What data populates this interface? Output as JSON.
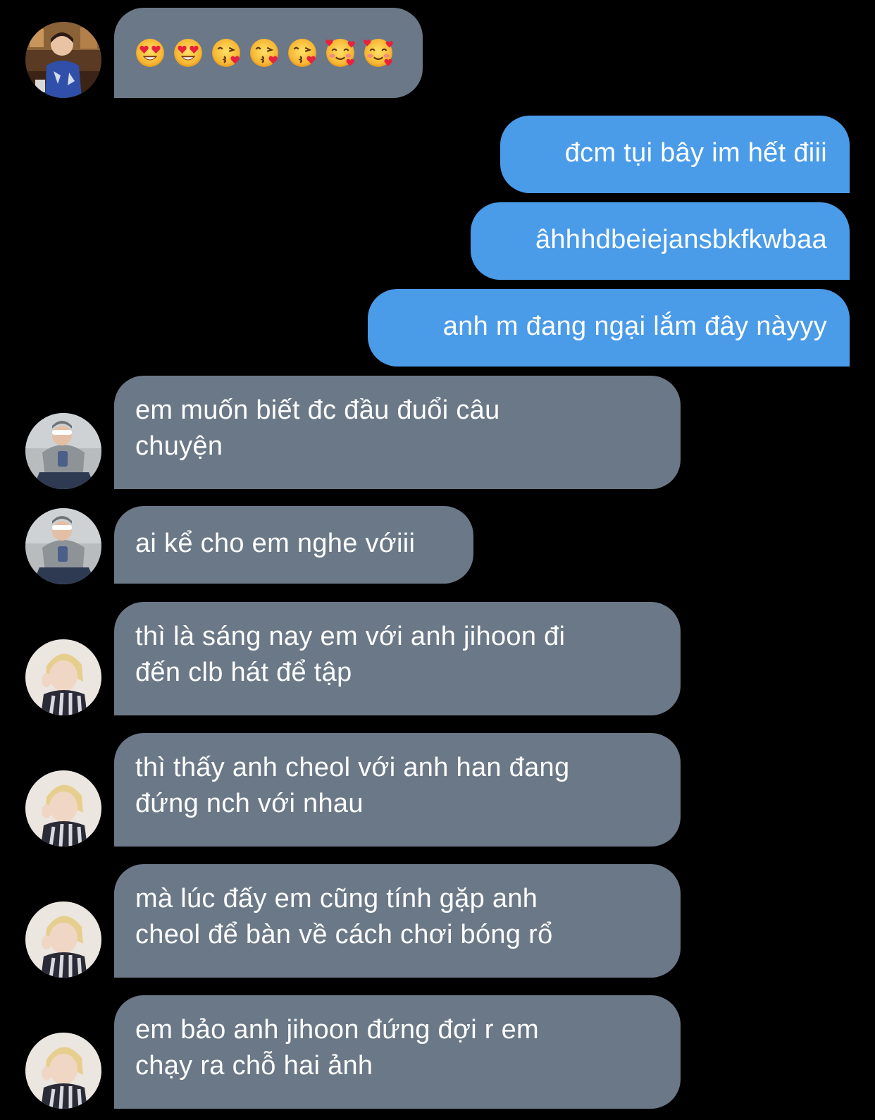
{
  "conversation": {
    "messages": [
      {
        "sender": "user1",
        "direction": "incoming",
        "emoji": [
          "heart-eyes",
          "heart-eyes",
          "kissing-heart",
          "kissing-heart",
          "kissing-heart",
          "smiling-hearts",
          "smiling-hearts"
        ]
      },
      {
        "sender": "me",
        "direction": "outgoing",
        "text": "đcm tụi bây im hết điii"
      },
      {
        "sender": "me",
        "direction": "outgoing",
        "text": "âhhhdbeiejansbkfkwbaa"
      },
      {
        "sender": "me",
        "direction": "outgoing",
        "text": "anh m đang ngại lắm đây nàyyy"
      },
      {
        "sender": "user2",
        "direction": "incoming",
        "line1": "em muốn biết đc đầu đuổi câu",
        "line2": "chuyện"
      },
      {
        "sender": "user2",
        "direction": "incoming",
        "text": "ai kể cho em nghe vớiii"
      },
      {
        "sender": "user3",
        "direction": "incoming",
        "line1": "thì là sáng nay em với anh jihoon đi",
        "line2": "đến clb hát để tập"
      },
      {
        "sender": "user3",
        "direction": "incoming",
        "line1": "thì thấy anh cheol với anh han đang",
        "line2": "đứng nch với nhau"
      },
      {
        "sender": "user3",
        "direction": "incoming",
        "line1": "mà lúc đấy em cũng tính gặp anh",
        "line2": "cheol để bàn về cách chơi bóng rổ"
      },
      {
        "sender": "user3",
        "direction": "incoming",
        "line1": "em bảo anh jihoon đứng đợi r em",
        "line2": "chạy ra chỗ hai ảnh"
      }
    ]
  },
  "colors": {
    "background": "#000000",
    "incoming_bubble": "#6b7887",
    "outgoing_bubble": "#4a9be8",
    "text": "#ffffff"
  }
}
